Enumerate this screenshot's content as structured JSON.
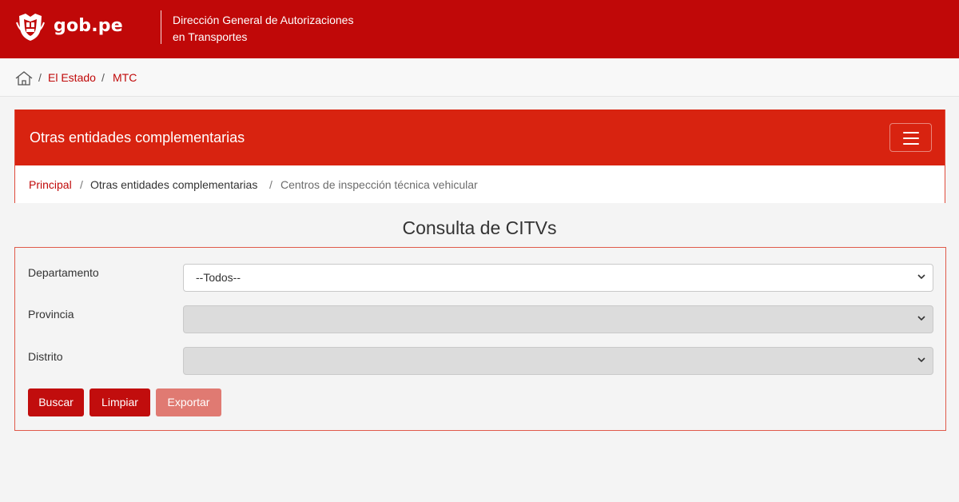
{
  "header": {
    "logo_text": "gob.pe",
    "title_line1": "Dirección General de Autorizaciones",
    "title_line2": "en Transportes"
  },
  "breadcrumb": {
    "icon": "home-icon",
    "items": [
      {
        "label": "El Estado"
      },
      {
        "label": "MTC"
      }
    ],
    "separator": "/"
  },
  "section": {
    "title": "Otras entidades complementarias",
    "menu_icon": "hamburger-icon",
    "breadcrumb": [
      {
        "label": "Principal"
      },
      {
        "label": "Otras entidades complementarias"
      },
      {
        "label": "Centros de inspección técnica vehicular"
      }
    ]
  },
  "page": {
    "title": "Consulta de CITVs"
  },
  "form": {
    "fields": [
      {
        "label": "Departamento",
        "value": "--Todos--",
        "enabled": true
      },
      {
        "label": "Provincia",
        "value": "",
        "enabled": false
      },
      {
        "label": "Distrito",
        "value": "",
        "enabled": false
      }
    ],
    "buttons": {
      "search": "Buscar",
      "clear": "Limpiar",
      "export": "Exportar"
    }
  },
  "colors": {
    "header_red": "#c00808",
    "section_red": "#d82310",
    "button_red": "#c10d0d",
    "button_disabled": "#e07a72",
    "link_red": "#c00808"
  }
}
